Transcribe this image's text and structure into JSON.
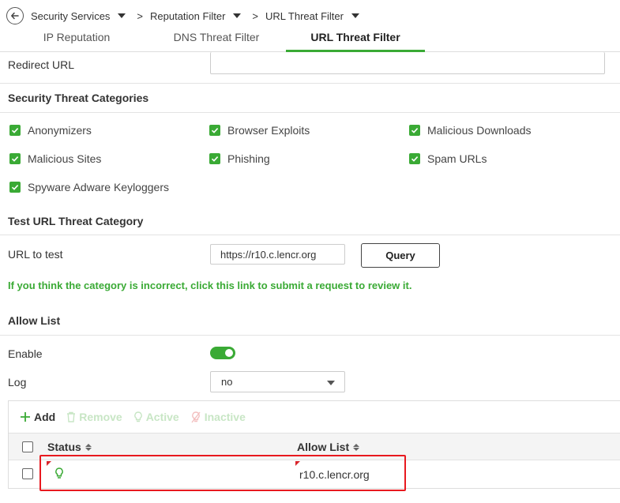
{
  "breadcrumb": {
    "items": [
      {
        "label": "Security Services"
      },
      {
        "label": "Reputation Filter"
      },
      {
        "label": "URL Threat Filter"
      }
    ],
    "separator": ">"
  },
  "tabs": [
    {
      "label": "IP Reputation",
      "active": false
    },
    {
      "label": "DNS Threat Filter",
      "active": false
    },
    {
      "label": "URL Threat Filter",
      "active": true
    }
  ],
  "redirect": {
    "label": "Redirect URL",
    "value": ""
  },
  "categories": {
    "title": "Security Threat Categories",
    "items": [
      {
        "label": "Anonymizers",
        "checked": true
      },
      {
        "label": "Browser Exploits",
        "checked": true
      },
      {
        "label": "Malicious Downloads",
        "checked": true
      },
      {
        "label": "Malicious Sites",
        "checked": true
      },
      {
        "label": "Phishing",
        "checked": true
      },
      {
        "label": "Spam URLs",
        "checked": true
      },
      {
        "label": "Spyware Adware Keyloggers",
        "checked": true
      }
    ]
  },
  "test": {
    "title": "Test URL Threat Category",
    "url_label": "URL to test",
    "url_value": "https://r10.c.lencr.org",
    "query_label": "Query",
    "review_link": "If you think the category is incorrect, click this link to submit a request to review it."
  },
  "allow_list": {
    "title": "Allow List",
    "enable_label": "Enable",
    "enable_on": true,
    "log_label": "Log",
    "log_value": "no",
    "toolbar": {
      "add": "Add",
      "remove": "Remove",
      "active": "Active",
      "inactive": "Inactive"
    },
    "columns": {
      "status": "Status",
      "allow_list": "Allow List"
    },
    "rows": [
      {
        "status": "active",
        "value": "r10.c.lencr.org"
      }
    ]
  },
  "colors": {
    "accent": "#3aaa35",
    "highlight": "#e8191f",
    "edit_marker": "#d8232a"
  }
}
